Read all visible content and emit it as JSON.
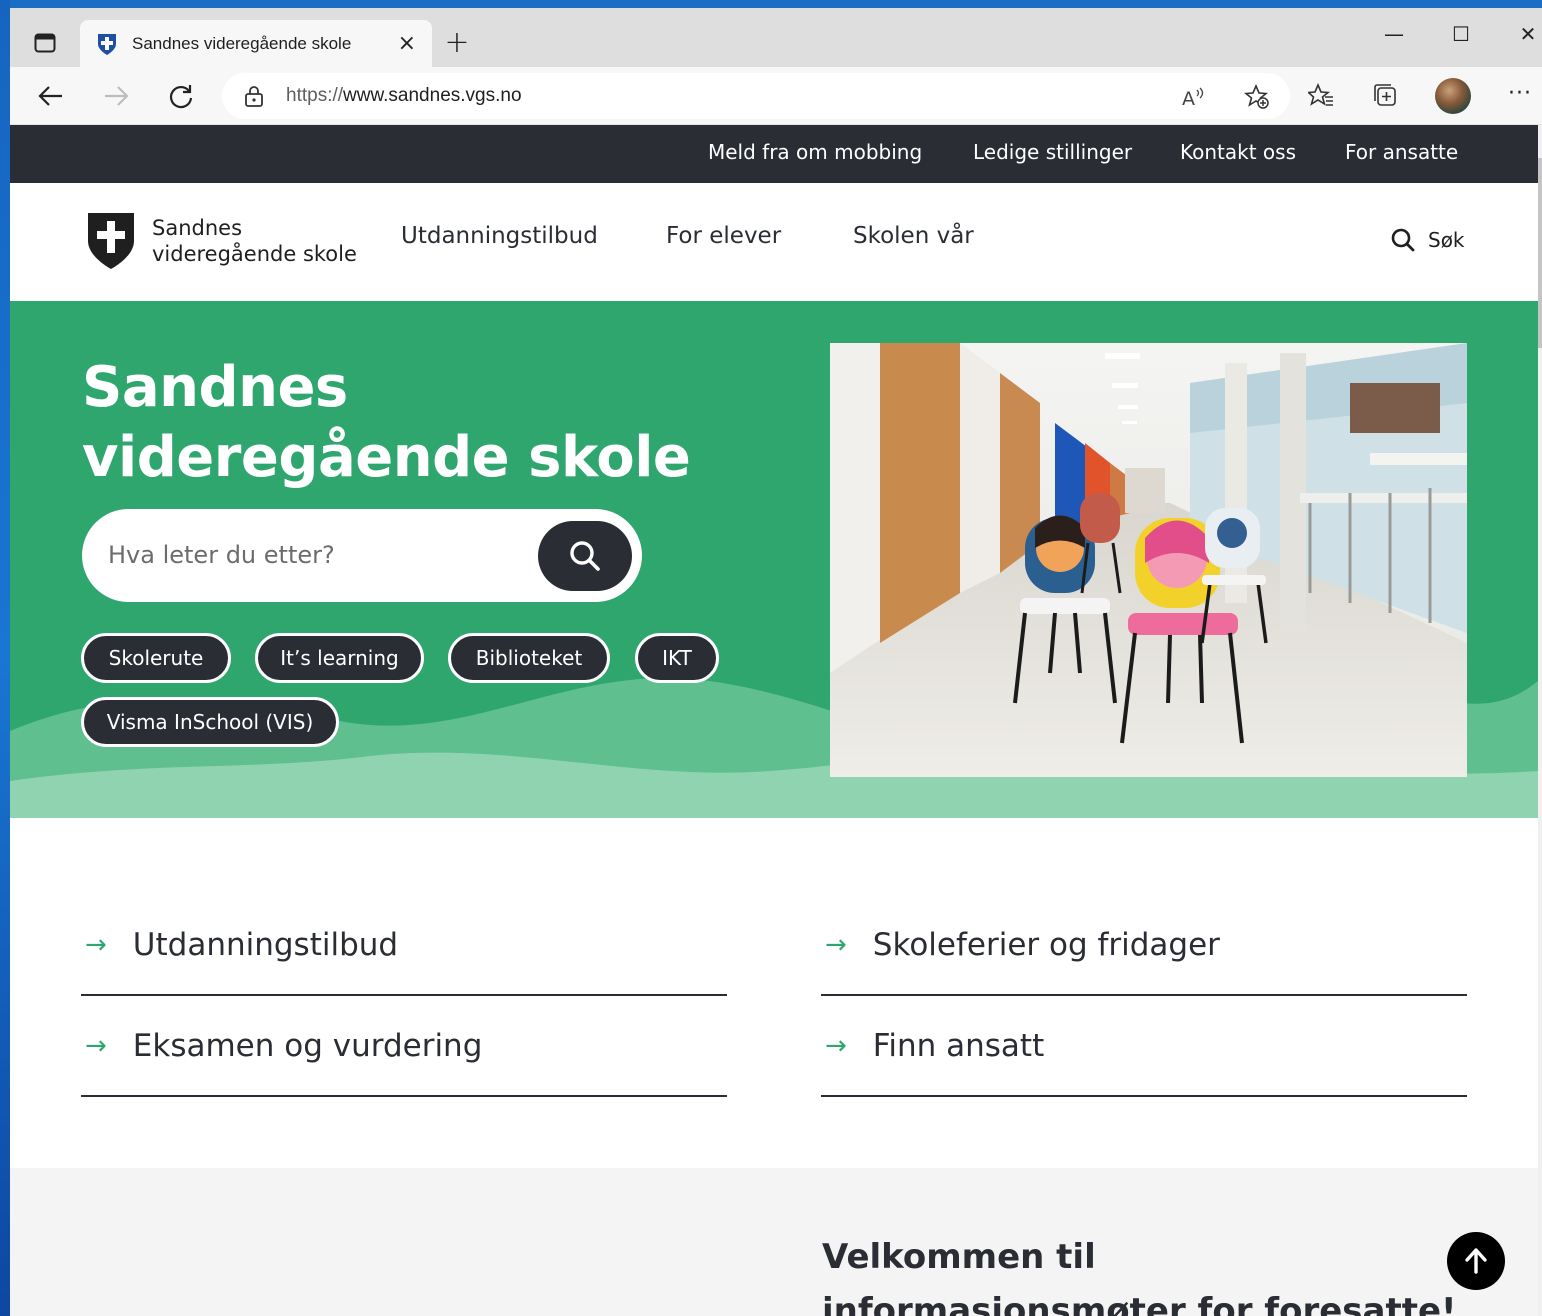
{
  "browser": {
    "tab": {
      "title": "Sandnes videregående skole",
      "close": "×"
    },
    "new_tab": "+",
    "window_controls": {
      "minimize": "—",
      "maximize": "☐",
      "close": "✕"
    },
    "address": {
      "scheme": "https://",
      "host": "www.sandnes.vgs.no"
    },
    "more": "···",
    "icons": [
      "tab-actions-icon",
      "back-icon",
      "forward-icon",
      "refresh-icon",
      "lock-icon",
      "read-aloud-icon",
      "add-favorite-icon",
      "favorites-icon",
      "collections-icon",
      "profile-avatar"
    ]
  },
  "site": {
    "topbar": {
      "links": [
        "Meld fra om mobbing",
        "Ledige stillinger",
        "Kontakt oss",
        "For ansatte"
      ]
    },
    "header": {
      "logo_line1": "Sandnes",
      "logo_line2": "videregående skole",
      "nav": [
        "Utdanningstilbud",
        "For elever",
        "Skolen vår"
      ],
      "search_label": "Søk"
    },
    "hero": {
      "title": "Sandnes videregående skole",
      "search_placeholder": "Hva leter du etter?",
      "chips": [
        "Skolerute",
        "It’s learning",
        "Biblioteket",
        "IKT",
        "Visma InSchool (VIS)"
      ]
    },
    "quick_links": [
      "Utdanningstilbud",
      "Skoleferier og fridager",
      "Eksamen og vurdering",
      "Finn ansatt"
    ],
    "quick_arrow": "→",
    "news": {
      "title": "Velkommen til informasjonsmøter for foresatte!"
    }
  },
  "colors": {
    "brand_green": "#2fa66e",
    "dark": "#2a2d34",
    "light_wave": "#8fd3b0"
  }
}
